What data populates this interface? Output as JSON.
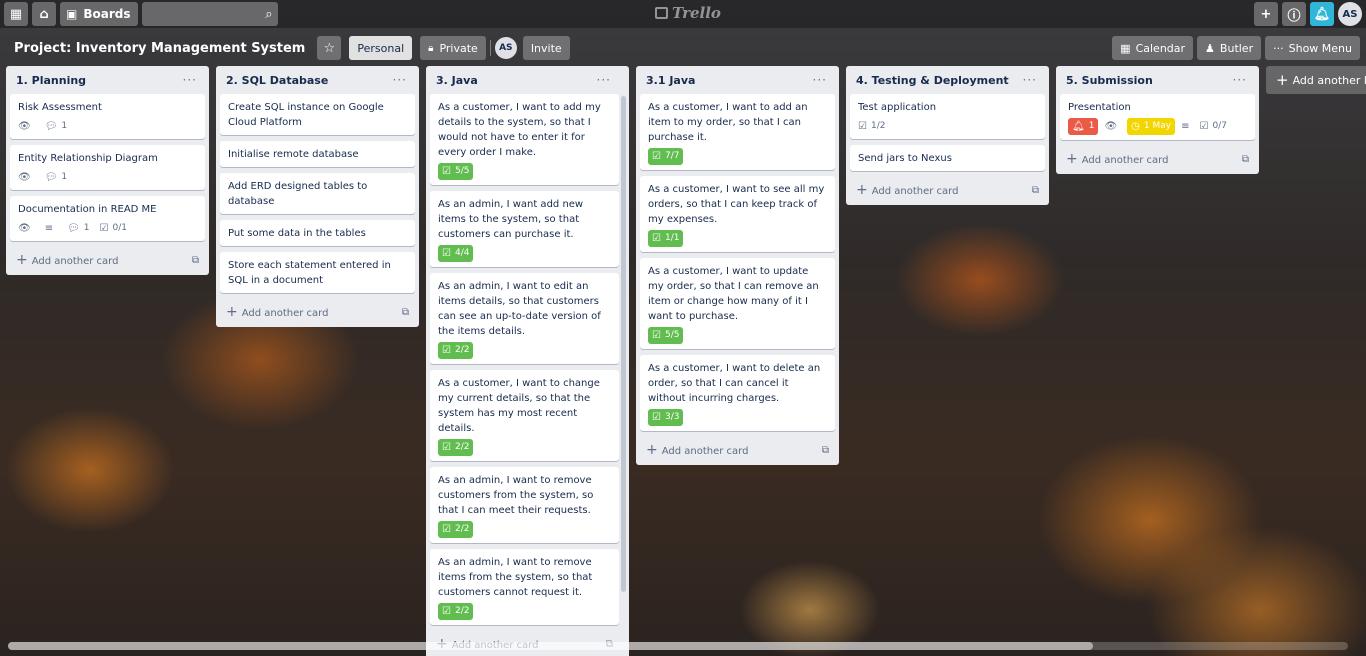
{
  "topbar": {
    "boards_label": "Boards",
    "logo_text": "Trello",
    "user_initials": "AS"
  },
  "board": {
    "title": "Project: Inventory Management System",
    "team_label": "Personal",
    "visibility_label": "Private",
    "member_initials": "AS",
    "invite_label": "Invite",
    "calendar_label": "Calendar",
    "butler_label": "Butler",
    "show_menu_label": "Show Menu",
    "add_list_label": "Add another list"
  },
  "add_card_label": "Add another card",
  "colors": {
    "done": "#61bd4f",
    "notification": "#eb5a46",
    "due": "#f2d600",
    "bell": "#2fb6d8"
  },
  "lists": [
    {
      "title": "1. Planning",
      "cards": [
        {
          "title": "Risk Assessment",
          "watch": true,
          "comments": "1"
        },
        {
          "title": "Entity Relationship Diagram",
          "watch": true,
          "comments": "1"
        },
        {
          "title": "Documentation in READ ME",
          "watch": true,
          "description": true,
          "comments": "1",
          "checklist": "0/1"
        }
      ]
    },
    {
      "title": "2. SQL Database",
      "cards": [
        {
          "title": "Create SQL instance on Google Cloud Platform"
        },
        {
          "title": "Initialise remote database"
        },
        {
          "title": "Add ERD designed tables to database"
        },
        {
          "title": "Put some data in the tables"
        },
        {
          "title": "Store each statement entered in SQL in a document"
        }
      ]
    },
    {
      "title": "3. Java",
      "cards": [
        {
          "title": "As a customer, I want to add my details to the system, so that I would not have to enter it for every order I make.",
          "checklist_done": "5/5"
        },
        {
          "title": "As an admin, I want add new items to the system, so that customers can purchase it.",
          "checklist_done": "4/4"
        },
        {
          "title": "As an admin, I want to edit an items details, so that customers can see an up-to-date version of the items details.",
          "checklist_done": "2/2"
        },
        {
          "title": "As a customer, I want to change my current details, so that the system has my most recent details.",
          "checklist_done": "2/2"
        },
        {
          "title": "As an admin, I want to remove customers from the system, so that I can meet their requests.",
          "checklist_done": "2/2"
        },
        {
          "title": "As an admin, I want to remove items from the system, so that customers cannot request it.",
          "checklist_done": "2/2"
        }
      ]
    },
    {
      "title": "3.1 Java",
      "cards": [
        {
          "title": "As a customer, I want to add an item to my order, so that I can purchase it.",
          "checklist_done": "7/7"
        },
        {
          "title": "As a customer, I want to see all my orders, so that I can keep track of my expenses.",
          "checklist_done": "1/1"
        },
        {
          "title": "As a customer, I want to update my order, so that I can remove an item or change how many of it I want to purchase.",
          "checklist_done": "5/5"
        },
        {
          "title": "As a customer, I want to delete an order, so that I can cancel it without incurring charges.",
          "checklist_done": "3/3"
        }
      ]
    },
    {
      "title": "4. Testing & Deployment",
      "cards": [
        {
          "title": "Test application",
          "checklist": "1/2"
        },
        {
          "title": "Send jars to Nexus"
        }
      ]
    },
    {
      "title": "5. Submission",
      "cards": [
        {
          "title": "Presentation",
          "notifications": "1",
          "watch": true,
          "due": "1 May",
          "description": true,
          "checklist": "0/7"
        }
      ]
    }
  ]
}
